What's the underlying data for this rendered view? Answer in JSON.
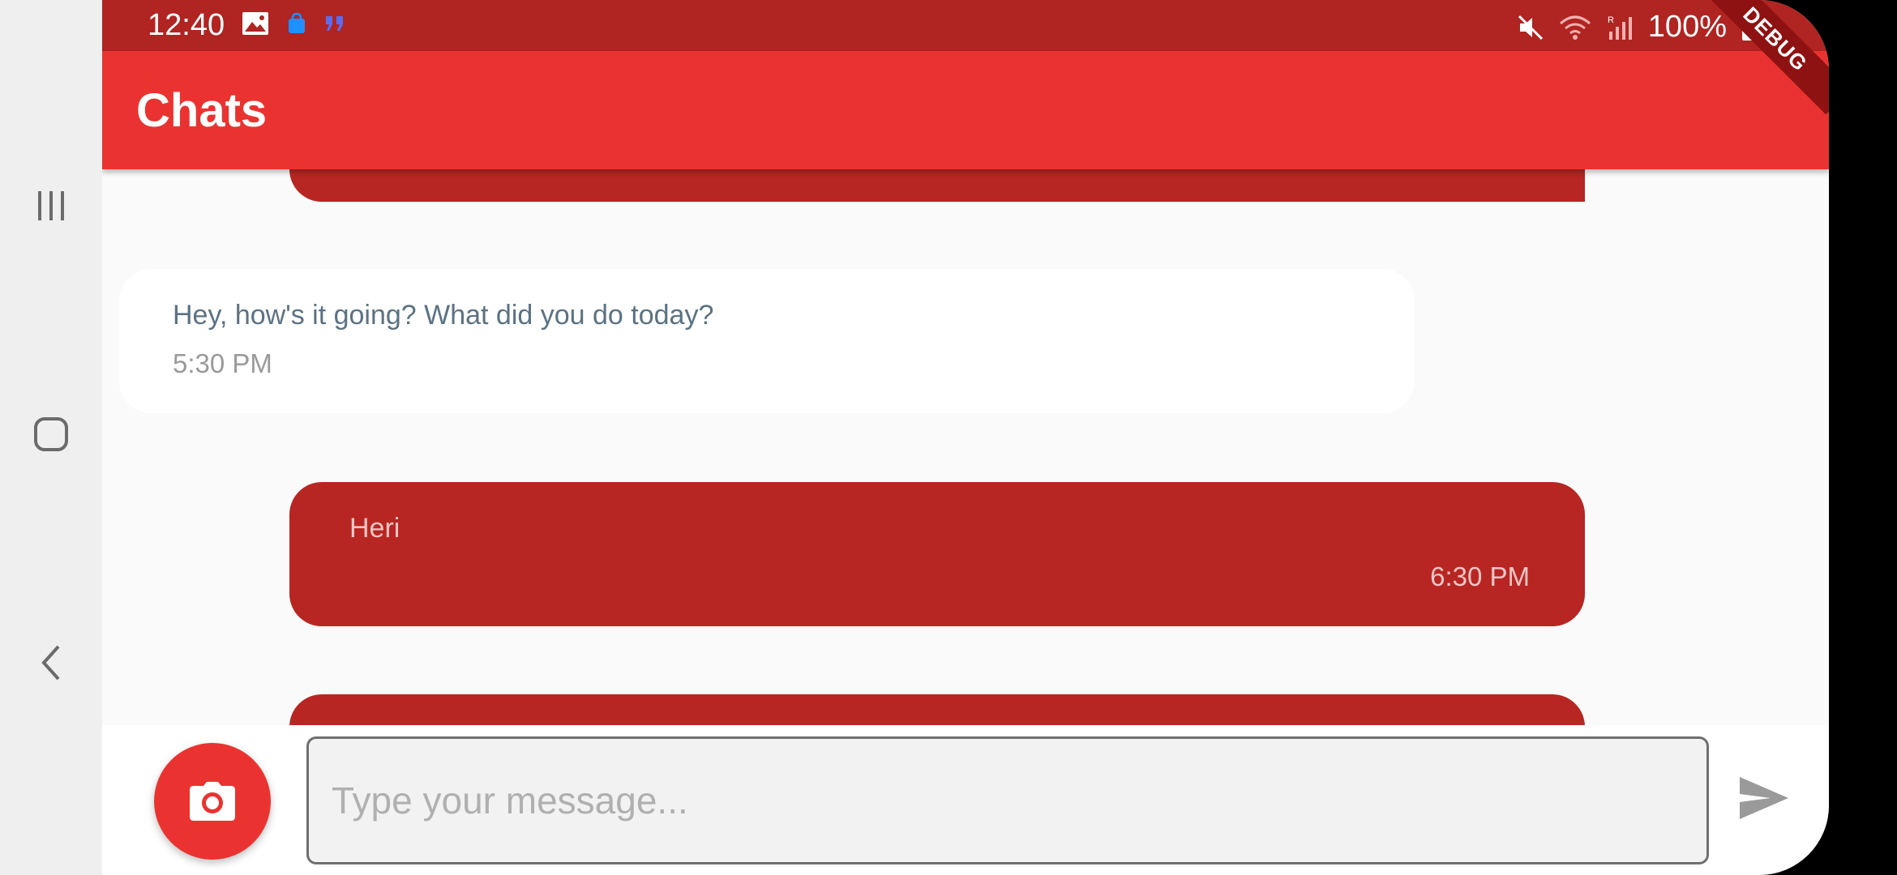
{
  "status_bar": {
    "time": "12:40",
    "battery": "100%",
    "icons_left": [
      "image-icon",
      "shopping-bag-icon",
      "quote-icon"
    ],
    "icons_right": [
      "mute-icon",
      "wifi-icon",
      "signal-icon",
      "battery-icon"
    ]
  },
  "app_bar": {
    "title": "Chats"
  },
  "debug_banner": "DEBUG",
  "messages": [
    {
      "type": "sent",
      "text": "",
      "time": ""
    },
    {
      "type": "received",
      "text": "Hey, how's it going? What did you do today?",
      "time": "5:30 PM"
    },
    {
      "type": "sent",
      "text": "Heri",
      "time": "6:30 PM"
    },
    {
      "type": "sent",
      "text": "",
      "time": ""
    }
  ],
  "composer": {
    "placeholder": "Type your message...",
    "value": ""
  },
  "nav_bar": {
    "buttons": [
      "recent-apps",
      "home",
      "back"
    ]
  },
  "colors": {
    "status_bar": "#b02421",
    "app_bar": "#ea3330",
    "sent_bubble": "#b72622",
    "received_bubble": "#ffffff",
    "background": "#fafafa"
  }
}
